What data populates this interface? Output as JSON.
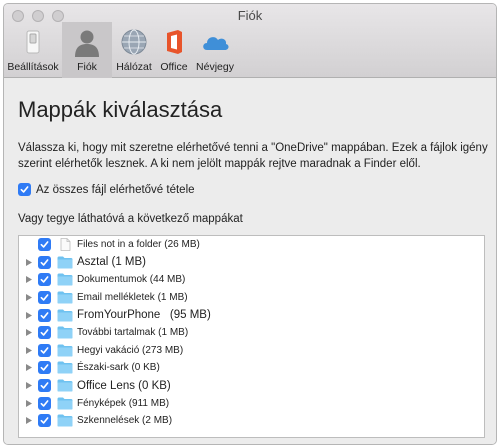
{
  "window": {
    "title": "Fiók"
  },
  "toolbar": {
    "items": [
      {
        "label": "Beállítások",
        "icon": "switch-icon"
      },
      {
        "label": "Fiók",
        "icon": "person-icon"
      },
      {
        "label": "Hálózat",
        "icon": "globe-icon"
      },
      {
        "label": "Office",
        "icon": "office-icon"
      },
      {
        "label": "Névjegy",
        "icon": "cloud-icon"
      }
    ],
    "active": "Fiók"
  },
  "main": {
    "heading": "Mappák kiválasztása",
    "description": "Válassza ki, hogy mit szeretne elérhetővé tenni a \"OneDrive\" mappában. Ezek a fájlok igény szerint elérhetők lesznek. A ki nem jelölt mappák rejtve maradnak a Finder elől.",
    "select_all_label": "Az összes fájl elérhetővé tétele",
    "select_all_checked": true,
    "folders_label": "Vagy tegye láthatóvá a következő mappákat",
    "folders": [
      {
        "name": "Files not in a folder (26 MB)",
        "type": "file",
        "checked": true
      },
      {
        "name": "Asztal (1 MB)",
        "type": "folder",
        "checked": true
      },
      {
        "name": "Dokumentumok (44 MB)",
        "type": "folder",
        "checked": true
      },
      {
        "name": "Email mellékletek (1 MB)",
        "type": "folder",
        "checked": true
      },
      {
        "name": "FromYourPhone   (95 MB)",
        "type": "folder",
        "checked": true
      },
      {
        "name": "További tartalmak (1 MB)",
        "type": "folder",
        "checked": true
      },
      {
        "name": "Hegyi vakáció (273 MB)",
        "type": "folder",
        "checked": true
      },
      {
        "name": "Északi-sark (0 KB)",
        "type": "folder",
        "checked": true
      },
      {
        "name": "Office Lens (0 KB)",
        "type": "folder",
        "checked": true
      },
      {
        "name": "Fényképek (911 MB)",
        "type": "folder",
        "checked": true
      },
      {
        "name": "Szkennelések (2 MB)",
        "type": "folder",
        "checked": true
      }
    ]
  },
  "colors": {
    "accent": "#2f7bf5",
    "folder": "#6fc2f0",
    "office": "#e8542b",
    "cloud": "#3f8fd8"
  }
}
